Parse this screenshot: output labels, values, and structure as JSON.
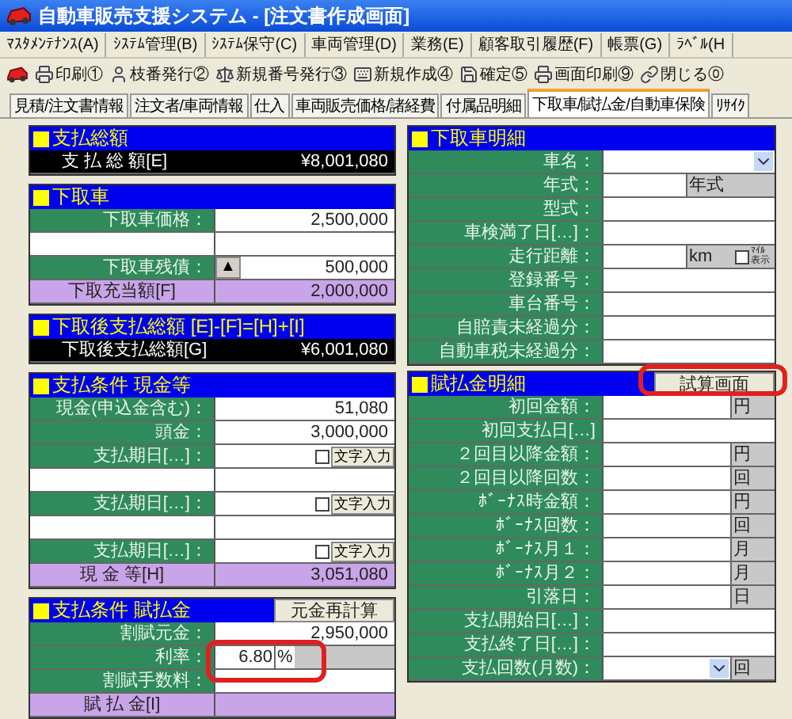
{
  "window": {
    "title": "自動車販売支援システム - [注文書作成画面]"
  },
  "menu": [
    "ﾏｽﾀﾒﾝﾃﾅﾝｽ(A)",
    "ｼｽﾃﾑ管理(B)",
    "ｼｽﾃﾑ保守(C)",
    "車両管理(D)",
    "業務(E)",
    "顧客取引履歴(F)",
    "帳票(G)",
    "ﾗﾍﾞﾙ(H"
  ],
  "toolbar": [
    {
      "label": "印刷①"
    },
    {
      "label": "枝番発行②"
    },
    {
      "label": "新規番号発行③"
    },
    {
      "label": "新規作成④"
    },
    {
      "label": "確定⑤"
    },
    {
      "label": "画面印刷⑨"
    },
    {
      "label": "閉じる⓪"
    }
  ],
  "tabs": [
    {
      "label": "見積/注文書情報",
      "selected": false
    },
    {
      "label": "注文者/車両情報",
      "selected": false
    },
    {
      "label": "仕入",
      "selected": false
    },
    {
      "label": "車両販売価格/諸経費",
      "selected": false
    },
    {
      "label": "付属品明細",
      "selected": false
    },
    {
      "label": "下取車/賦払金/自動車保険",
      "selected": true
    },
    {
      "label": "ﾘｻｲｸ",
      "selected": false
    }
  ],
  "left_sections": [
    {
      "title": "支払総額",
      "rows": [
        {
          "kind": "grand",
          "label": "支 払 総 額[E]",
          "value": "¥8,001,080"
        }
      ]
    },
    {
      "title": "下取車",
      "rows": [
        {
          "kind": "field",
          "label": "下取車価格：",
          "value": "2,500,000"
        },
        {
          "kind": "spacer"
        },
        {
          "kind": "stepper",
          "label": "下取車残債：",
          "symbol": "▲",
          "value": "500,000"
        },
        {
          "kind": "total",
          "label": "下取充当額[F]",
          "value": "2,000,000"
        }
      ]
    },
    {
      "title": "下取後支払総額 [E]-[F]=[H]+[I]",
      "rows": [
        {
          "kind": "grand",
          "label": "下取後支払総額[G]",
          "value": "¥6,001,080"
        }
      ]
    },
    {
      "title": "支払条件 現金等",
      "rows": [
        {
          "kind": "field",
          "label": "現金(申込金含む)：",
          "value": "51,080"
        },
        {
          "kind": "field",
          "label": "頭金：",
          "value": "3,000,000"
        },
        {
          "kind": "date",
          "label": "支払期日[…]：",
          "checked": false,
          "button": "文字入力"
        },
        {
          "kind": "spacer"
        },
        {
          "kind": "date",
          "label": "支払期日[…]：",
          "checked": false,
          "button": "文字入力"
        },
        {
          "kind": "spacer"
        },
        {
          "kind": "date",
          "label": "支払期日[…]：",
          "checked": false,
          "button": "文字入力"
        },
        {
          "kind": "total",
          "label": "現 金 等[H]",
          "value": "3,051,080"
        }
      ]
    },
    {
      "title": "支払条件 賦払金",
      "button": "元金再計算",
      "rows": [
        {
          "kind": "field",
          "label": "割賦元金：",
          "value": "2,950,000"
        },
        {
          "kind": "rate",
          "label": "利率：",
          "value": "6.80",
          "unit": "%",
          "highlighted": true
        },
        {
          "kind": "field",
          "label": "割賦手数料："
        },
        {
          "kind": "total",
          "label": "賦 払 金[I]"
        }
      ]
    }
  ],
  "right_sections": [
    {
      "title": "下取車明細",
      "rows": [
        {
          "kind": "dropdown",
          "label": "車名："
        },
        {
          "kind": "tag",
          "label": "年式：",
          "tag": "年式"
        },
        {
          "kind": "field",
          "label": "型式："
        },
        {
          "kind": "field",
          "label": "車検満了日[…]："
        },
        {
          "kind": "mileage",
          "label": "走行距離：",
          "unit": "km",
          "checked": false,
          "check_label": "ﾏｲﾙ表示"
        },
        {
          "kind": "field",
          "label": "登録番号："
        },
        {
          "kind": "field",
          "label": "車台番号："
        },
        {
          "kind": "field",
          "label": "自賠責未経過分："
        },
        {
          "kind": "field",
          "label": "自動車税未経過分："
        }
      ]
    },
    {
      "title": "賦払金明細",
      "button": "試算画面",
      "button_highlighted": true,
      "rows": [
        {
          "kind": "unit",
          "label": "初回金額：",
          "unit": "円"
        },
        {
          "kind": "field",
          "label": "初回支払日[…]"
        },
        {
          "kind": "unit",
          "label": "２回目以降金額：",
          "unit": "円"
        },
        {
          "kind": "unit",
          "label": "２回目以降回数：",
          "unit": "回"
        },
        {
          "kind": "unit",
          "label": "ﾎﾞｰﾅｽ時金額：",
          "unit": "円"
        },
        {
          "kind": "unit",
          "label": "ﾎﾞｰﾅｽ回数：",
          "unit": "回"
        },
        {
          "kind": "unit",
          "label": "ﾎﾞｰﾅｽ月１：",
          "unit": "月"
        },
        {
          "kind": "unit",
          "label": "ﾎﾞｰﾅｽ月２：",
          "unit": "月"
        },
        {
          "kind": "unit",
          "label": "引落日：",
          "unit": "日"
        },
        {
          "kind": "field",
          "label": "支払開始日[…]："
        },
        {
          "kind": "field",
          "label": "支払終了日[…]："
        },
        {
          "kind": "dropdown_unit",
          "label": "支払回数(月数)：",
          "unit": "回"
        }
      ]
    }
  ]
}
